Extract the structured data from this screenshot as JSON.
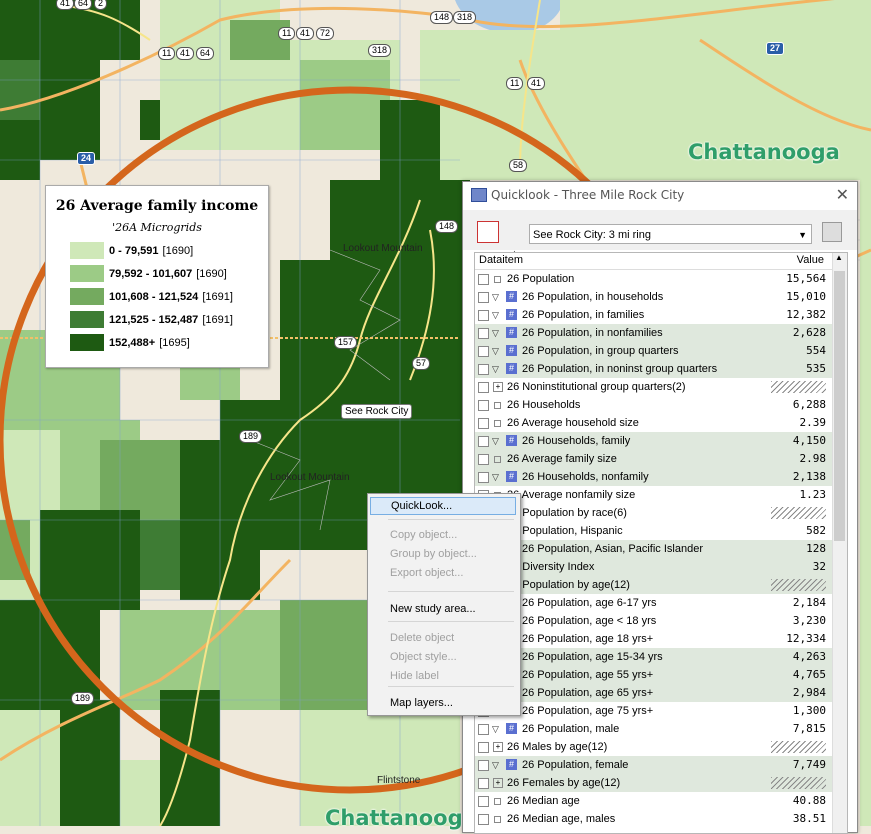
{
  "map": {
    "city_labels": [
      "Chattanooga",
      "Chattanoog"
    ],
    "place_labels": [
      "Lookout Mountain",
      "Lookout Mountain",
      "Flintstone"
    ],
    "poi_label": "See Rock City",
    "shields": [
      "41",
      "64",
      "2",
      "148",
      "318",
      "11",
      "41",
      "64",
      "72",
      "11",
      "41",
      "72",
      "318",
      "11",
      "41",
      "27",
      "24",
      "58",
      "148",
      "157",
      "57",
      "189",
      "189"
    ]
  },
  "legend": {
    "title": "26 Average family income",
    "subtitle": "'26A Microgrids",
    "classes": [
      {
        "label": "0 - 79,591",
        "count": "[1690]",
        "color": "#cfe8b8"
      },
      {
        "label": "79,592 - 101,607",
        "count": "[1690]",
        "color": "#9ccb86"
      },
      {
        "label": "101,608 - 121,524",
        "count": "[1691]",
        "color": "#74aa5f"
      },
      {
        "label": "121,525 - 152,487",
        "count": "[1691]",
        "color": "#3e7c34"
      },
      {
        "label": "152,488+",
        "count": "[1695]",
        "color": "#1e5a12"
      }
    ]
  },
  "quicklook": {
    "title": "Quicklook - Three Mile Rock City",
    "area_select": "See Rock City: 3 mi ring",
    "columns": {
      "item": "Dataitem",
      "value": "Value"
    },
    "rows": [
      {
        "label": "26 Population",
        "value": "15,564",
        "kind": "sq",
        "shade": false
      },
      {
        "label": "26 Population, in households",
        "value": "15,010",
        "kind": "hash",
        "shade": false
      },
      {
        "label": "26 Population, in families",
        "value": "12,382",
        "kind": "hash",
        "shade": false
      },
      {
        "label": "26 Population, in nonfamilies",
        "value": "2,628",
        "kind": "hash",
        "shade": true
      },
      {
        "label": "26 Population, in group quarters",
        "value": "554",
        "kind": "hash",
        "shade": true
      },
      {
        "label": "26 Population, in noninst group quarters",
        "value": "535",
        "kind": "hash",
        "shade": true
      },
      {
        "label": "26 Noninstitutional group quarters(2)",
        "value": "",
        "kind": "exp",
        "shade": false
      },
      {
        "label": "26 Households",
        "value": "6,288",
        "kind": "sq",
        "shade": false
      },
      {
        "label": "26 Average household size",
        "value": "2.39",
        "kind": "sq",
        "shade": false
      },
      {
        "label": "26 Households, family",
        "value": "4,150",
        "kind": "hash",
        "shade": true
      },
      {
        "label": "26 Average family size",
        "value": "2.98",
        "kind": "sq",
        "shade": true
      },
      {
        "label": "26 Households, nonfamily",
        "value": "2,138",
        "kind": "hash",
        "shade": true
      },
      {
        "label": "26 Average nonfamily size",
        "value": "1.23",
        "kind": "sq",
        "shade": false
      },
      {
        "label": "26 Population by race(6)",
        "value": "",
        "kind": "exp",
        "shade": false
      },
      {
        "label": "26 Population, Hispanic",
        "value": "582",
        "kind": "sq",
        "shade": false
      },
      {
        "label": "26 Population, Asian, Pacific Islander",
        "value": "128",
        "kind": "hash",
        "shade": true
      },
      {
        "label": "26 Diversity Index",
        "value": "32",
        "kind": "sq",
        "shade": true
      },
      {
        "label": "26 Population by age(12)",
        "value": "",
        "kind": "exp",
        "shade": true
      },
      {
        "label": "26 Population, age 6-17 yrs",
        "value": "2,184",
        "kind": "hash",
        "shade": false
      },
      {
        "label": "26 Population, age < 18 yrs",
        "value": "3,230",
        "kind": "hash",
        "shade": false
      },
      {
        "label": "26 Population, age 18 yrs+",
        "value": "12,334",
        "kind": "hash",
        "shade": false
      },
      {
        "label": "26 Population, age 15-34 yrs",
        "value": "4,263",
        "kind": "hash",
        "shade": true
      },
      {
        "label": "26 Population, age 55 yrs+",
        "value": "4,765",
        "kind": "hash",
        "shade": true
      },
      {
        "label": "26 Population, age 65 yrs+",
        "value": "2,984",
        "kind": "hash",
        "shade": true
      },
      {
        "label": "26 Population, age 75 yrs+",
        "value": "1,300",
        "kind": "hash",
        "shade": false
      },
      {
        "label": "26 Population, male",
        "value": "7,815",
        "kind": "hash",
        "shade": false
      },
      {
        "label": "26 Males by age(12)",
        "value": "",
        "kind": "exp",
        "shade": false
      },
      {
        "label": "26 Population, female",
        "value": "7,749",
        "kind": "hash",
        "shade": true
      },
      {
        "label": "26 Females by age(12)",
        "value": "",
        "kind": "exp",
        "shade": true
      },
      {
        "label": "26 Median age",
        "value": "40.88",
        "kind": "sq",
        "shade": false
      },
      {
        "label": "26 Median age, males",
        "value": "38.51",
        "kind": "sq",
        "shade": false
      }
    ]
  },
  "context_menu": {
    "items": [
      {
        "label": "QuickLook...",
        "state": "highlight"
      },
      {
        "label": "Copy object...",
        "state": "disabled"
      },
      {
        "label": "Group by object...",
        "state": "disabled"
      },
      {
        "label": "Export object...",
        "state": "disabled"
      },
      {
        "label": "New study area...",
        "state": "normal"
      },
      {
        "label": "Delete object",
        "state": "disabled"
      },
      {
        "label": "Object style...",
        "state": "disabled"
      },
      {
        "label": "Hide label",
        "state": "disabled"
      },
      {
        "label": "Map layers...",
        "state": "normal"
      }
    ]
  }
}
